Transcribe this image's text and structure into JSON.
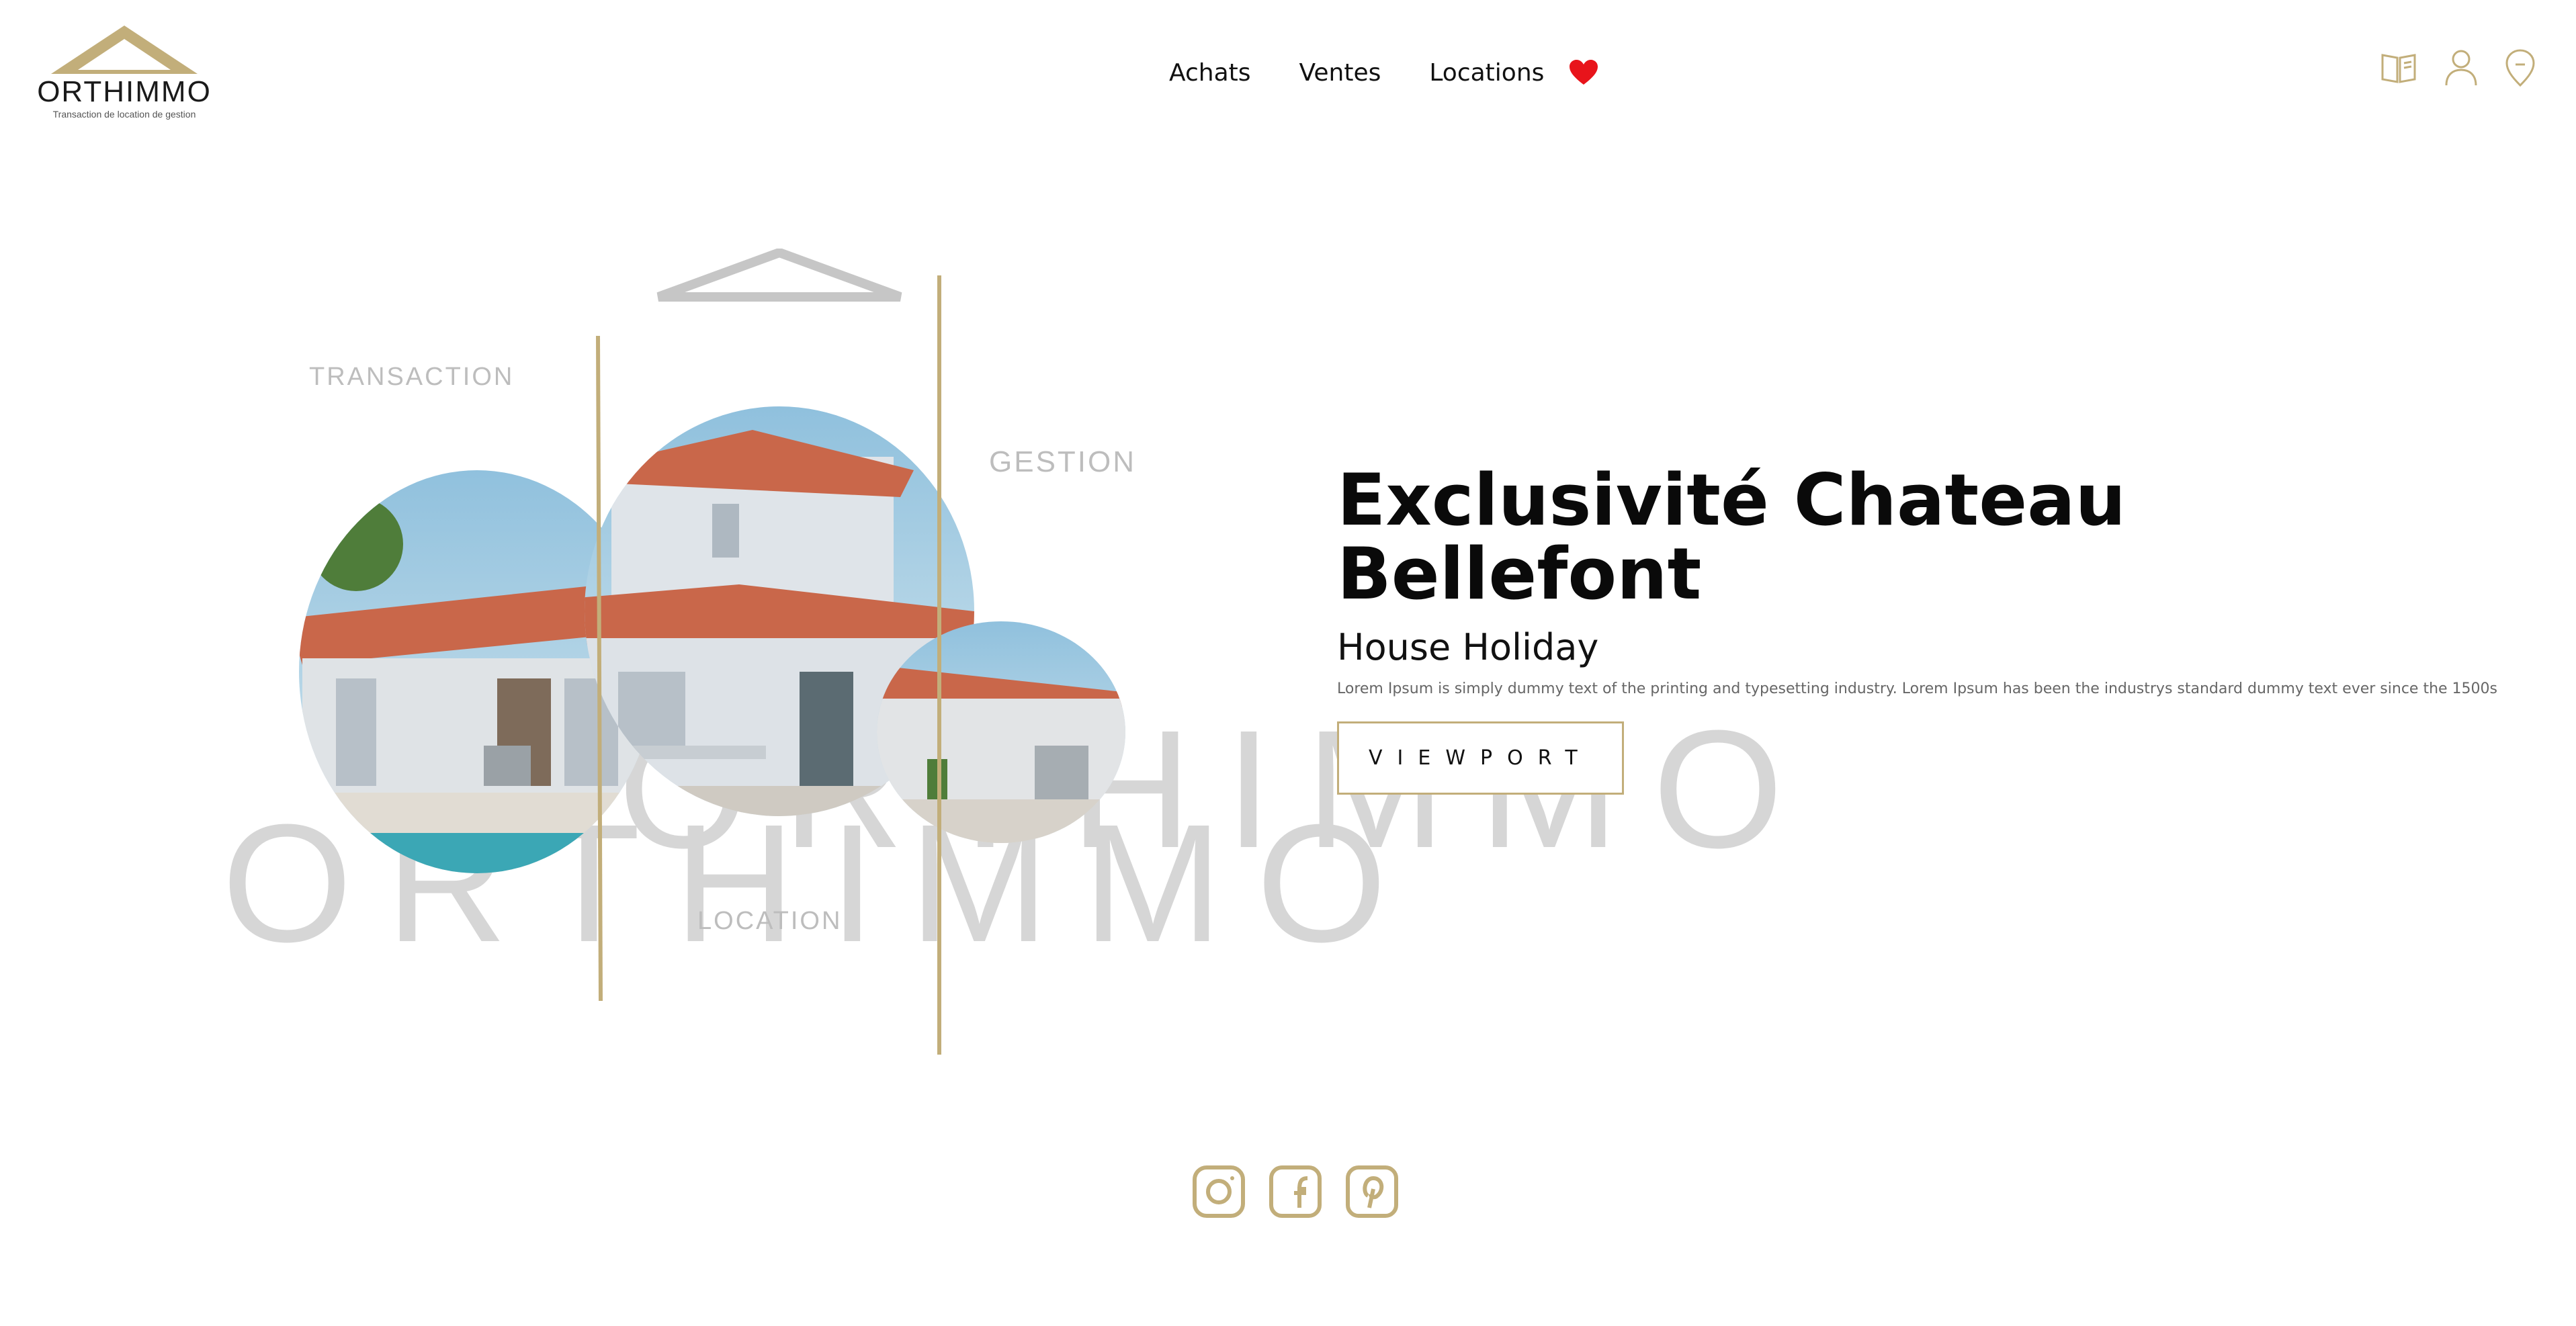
{
  "brand": {
    "name": "ORTHIMMO",
    "tagline": "Transaction de location de gestion",
    "accent": "#c2ae7a"
  },
  "nav": {
    "items": [
      {
        "label": "Achats"
      },
      {
        "label": "Ventes"
      },
      {
        "label": "Locations"
      }
    ],
    "favorite_icon": "heart-icon",
    "favorite_color": "#e8141b"
  },
  "header_icons": [
    "book-icon",
    "user-icon",
    "location-pin-icon"
  ],
  "hero_art": {
    "words": [
      "TRANSACTION",
      "GESTION",
      "LOCATION"
    ],
    "big_word_line1": "ORTHIMMO",
    "big_word_line2": "ORTHIMMO",
    "photo_icon": "house-photo"
  },
  "hero": {
    "title_line1": "Exclusivité Chateau",
    "title_line2": "Bellefont",
    "subtitle": "House Holiday",
    "description": "Lorem Ipsum is simply dummy text of the printing and typesetting industry. Lorem Ipsum has been the industrys standard dummy text ever since the 1500s",
    "cta_label": "VIEWPORT"
  },
  "social": [
    "instagram-icon",
    "facebook-icon",
    "pinterest-icon"
  ]
}
